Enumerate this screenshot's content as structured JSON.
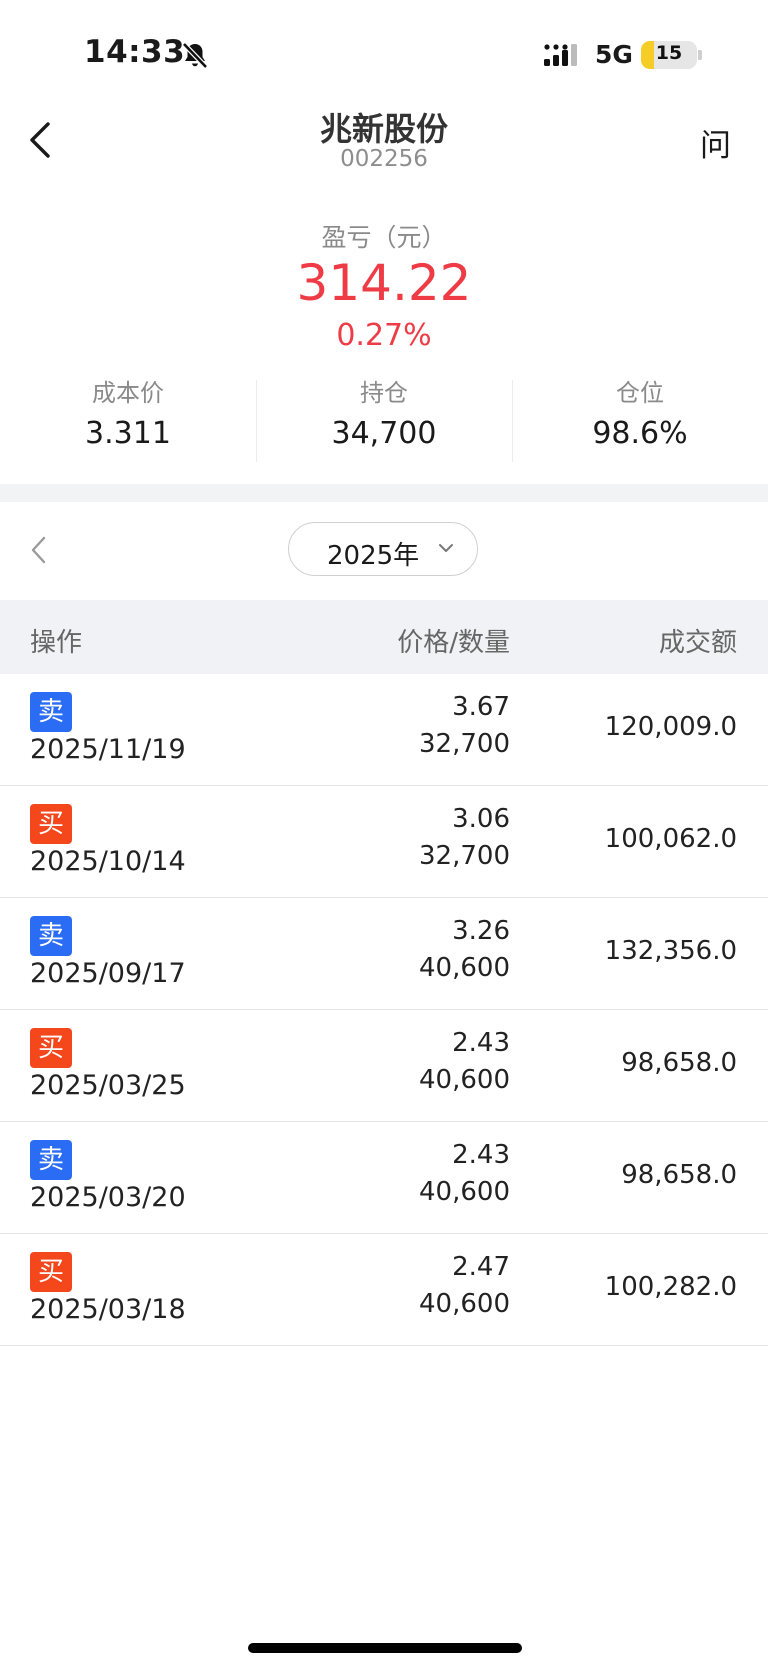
{
  "status_bar": {
    "time": "14:33",
    "network": "5G",
    "battery": "15"
  },
  "header": {
    "title": "兆新股份",
    "code": "002256",
    "ask_label": "问"
  },
  "summary": {
    "pl_label": "盈亏（元）",
    "pl_value": "314.22",
    "pl_percent": "0.27%",
    "stats": [
      {
        "label": "成本价",
        "value": "3.311"
      },
      {
        "label": "持仓",
        "value": "34,700"
      },
      {
        "label": "仓位",
        "value": "98.6%"
      }
    ]
  },
  "year_selector": {
    "value": "2025年"
  },
  "table": {
    "headers": {
      "op": "操作",
      "price_qty": "价格/数量",
      "amount": "成交额"
    },
    "rows": [
      {
        "type": "卖",
        "side": "sell",
        "date": "2025/11/19",
        "price": "3.67",
        "qty": "32,700",
        "amount": "120,009.0"
      },
      {
        "type": "买",
        "side": "buy",
        "date": "2025/10/14",
        "price": "3.06",
        "qty": "32,700",
        "amount": "100,062.0"
      },
      {
        "type": "卖",
        "side": "sell",
        "date": "2025/09/17",
        "price": "3.26",
        "qty": "40,600",
        "amount": "132,356.0"
      },
      {
        "type": "买",
        "side": "buy",
        "date": "2025/03/25",
        "price": "2.43",
        "qty": "40,600",
        "amount": "98,658.0"
      },
      {
        "type": "卖",
        "side": "sell",
        "date": "2025/03/20",
        "price": "2.43",
        "qty": "40,600",
        "amount": "98,658.0"
      },
      {
        "type": "买",
        "side": "buy",
        "date": "2025/03/18",
        "price": "2.47",
        "qty": "40,600",
        "amount": "100,282.0"
      }
    ]
  },
  "colors": {
    "profit": "#ee3b46",
    "sell_badge": "#2a6df4",
    "buy_badge": "#f4471c",
    "battery": "#f5cd26"
  },
  "icons": {
    "back": "chevron-left-icon",
    "mute": "bell-slash-icon",
    "signal": "signal-bars-icon",
    "year_prev": "chevron-left-icon",
    "year_dropdown": "chevron-down-icon"
  }
}
